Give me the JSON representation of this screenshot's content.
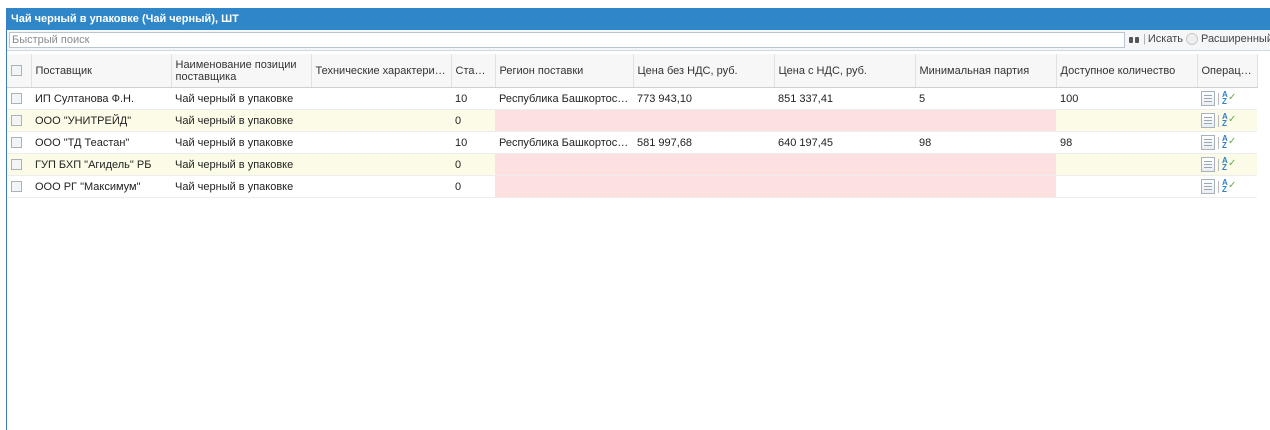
{
  "window": {
    "title": "Чай черный в упаковке (Чай черный), ШТ"
  },
  "search": {
    "placeholder": "Быстрый поиск",
    "find_label": "Искать",
    "advanced_label": "Расширенный поиск"
  },
  "columns": {
    "supplier": "Поставщик",
    "item_name": "Наименование позиции поставщика",
    "specs": "Технические характеристики",
    "rate": "Ставка",
    "region": "Регион поставки",
    "price_no_vat": "Цена без НДС, руб.",
    "price_vat": "Цена с НДС, руб.",
    "min_batch": "Минимальная партия",
    "available": "Доступное количество",
    "operations": "Операции"
  },
  "rows": [
    {
      "supplier": "ИП Султанова Ф.Н.",
      "item_name": "Чай черный в упаковке",
      "specs": "",
      "rate": "10",
      "region": "Республика Башкортостан",
      "price_no_vat": "773 943,10",
      "price_vat": "851 337,41",
      "min_batch": "5",
      "available": "100"
    },
    {
      "supplier": "ООО \"УНИТРЕЙД\"",
      "item_name": "Чай черный в упаковке",
      "specs": "",
      "rate": "0",
      "region": "",
      "price_no_vat": "",
      "price_vat": "",
      "min_batch": "",
      "available": ""
    },
    {
      "supplier": "ООО \"ТД Теастан\"",
      "item_name": "Чай черный в упаковке",
      "specs": "",
      "rate": "10",
      "region": "Республика Башкортостан",
      "price_no_vat": "581 997,68",
      "price_vat": "640 197,45",
      "min_batch": "98",
      "available": "98"
    },
    {
      "supplier": "ГУП БХП \"Агидель\" РБ",
      "item_name": "Чай черный в упаковке",
      "specs": "",
      "rate": "0",
      "region": "",
      "price_no_vat": "",
      "price_vat": "",
      "min_batch": "",
      "available": ""
    },
    {
      "supplier": "ООО РГ \"Максимум\"",
      "item_name": "Чай черный в упаковке",
      "specs": "",
      "rate": "0",
      "region": "",
      "price_no_vat": "",
      "price_vat": "",
      "min_batch": "",
      "available": ""
    }
  ],
  "colors": {
    "titlebar": "#2f86c9",
    "alt_row": "#fcfbe7",
    "missing_cell": "#fde0e0"
  },
  "icons": {
    "find": "binoculars-icon",
    "advanced": "advanced-search-icon",
    "row_doc": "document-icon",
    "row_sort": "sort-az-icon"
  }
}
